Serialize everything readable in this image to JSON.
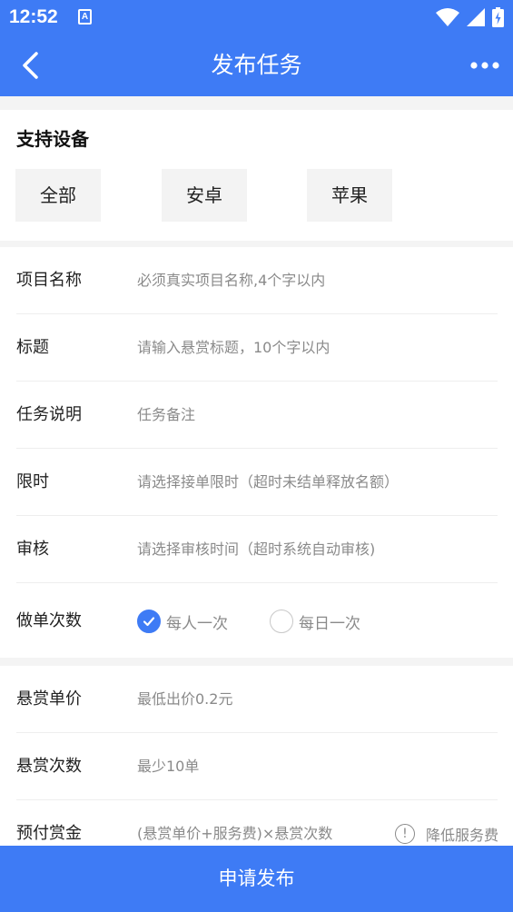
{
  "status_bar": {
    "time": "12:52",
    "app_badge": "A"
  },
  "header": {
    "title": "发布任务"
  },
  "device_section": {
    "title": "支持设备",
    "options": [
      "全部",
      "安卓",
      "苹果"
    ]
  },
  "form1": {
    "project_name": {
      "label": "项目名称",
      "placeholder": "必须真实项目名称,4个字以内"
    },
    "title": {
      "label": "标题",
      "placeholder": "请输入悬赏标题，10个字以内"
    },
    "description": {
      "label": "任务说明",
      "placeholder": "任务备注"
    },
    "time_limit": {
      "label": "限时",
      "placeholder": "请选择接单限时（超时未结单释放名额）"
    },
    "review": {
      "label": "审核",
      "placeholder": "请选择审核时间（超时系统自动审核)"
    },
    "frequency": {
      "label": "做单次数",
      "options": [
        {
          "text": "每人一次",
          "checked": true
        },
        {
          "text": "每日一次",
          "checked": false
        }
      ]
    }
  },
  "form2": {
    "unit_price": {
      "label": "悬赏单价",
      "placeholder": "最低出价0.2元"
    },
    "count": {
      "label": "悬赏次数",
      "placeholder": "最少10单"
    },
    "prepay": {
      "label": "预付赏金",
      "value": "(悬赏单价+服务费)×悬赏次数",
      "tip": "降低服务费"
    }
  },
  "submit_button": {
    "label": "申请发布"
  },
  "colors": {
    "primary": "#3e7bf5",
    "text": "#222222",
    "placeholder": "#8a8a8a",
    "background": "#f4f4f4"
  }
}
